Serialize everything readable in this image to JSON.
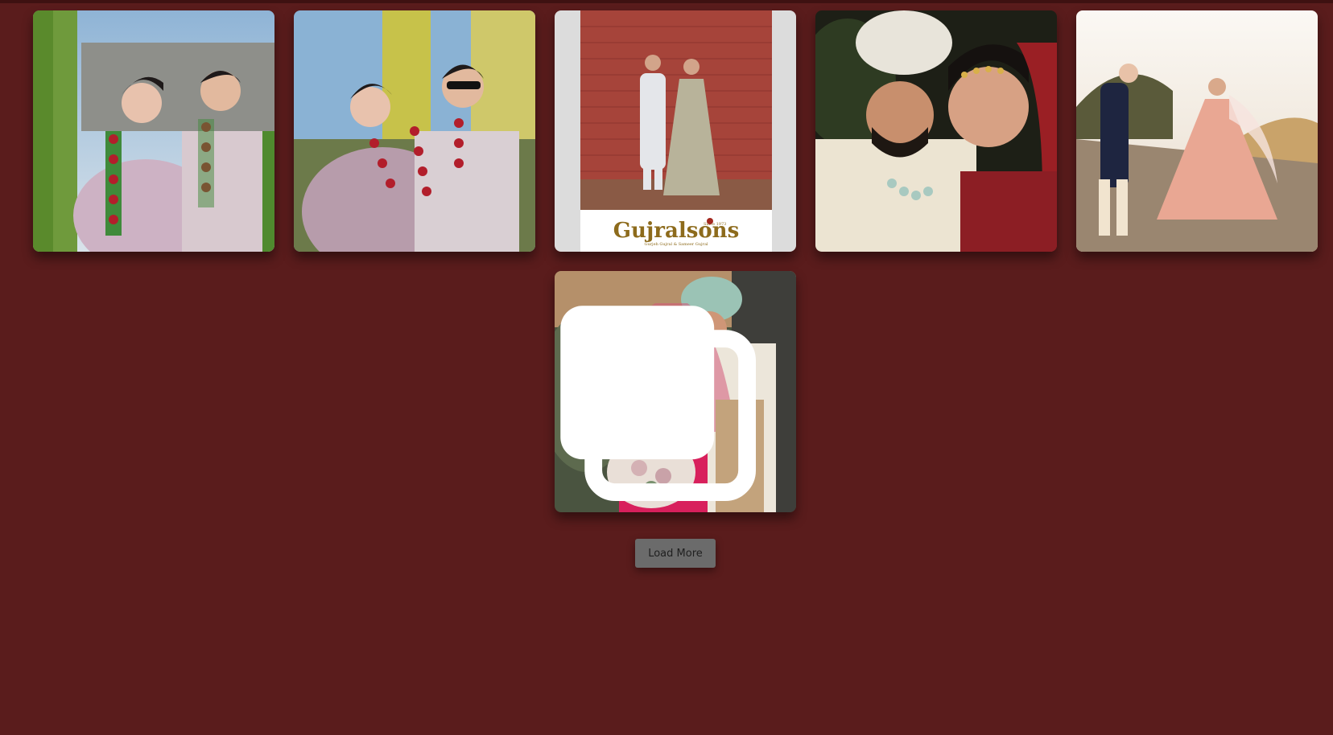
{
  "colors": {
    "page_background": "#5a1c1c",
    "button_background": "#6b6b6b",
    "button_text": "#1f1f1f"
  },
  "gallery": {
    "posts": [
      {
        "subject": "couple-garlands-outdoor",
        "multi_image": false
      },
      {
        "subject": "couple-garlands-sunglasses",
        "multi_image": false
      },
      {
        "subject": "couple-brick-wall-catalog",
        "multi_image": false,
        "brand_text": "Gujralsons",
        "brand_since": "Since 1973",
        "brand_subline": "Gurjeh Gujral & Sameer Gujral"
      },
      {
        "subject": "groom-turban-bride-closeup",
        "multi_image": false
      },
      {
        "subject": "couple-twirl-field",
        "multi_image": false
      },
      {
        "subject": "bride-pink-lehenga-groom-turban",
        "multi_image": true
      }
    ],
    "multi_image_icon": "carousel-icon"
  },
  "load_more": {
    "label": "Load More"
  }
}
